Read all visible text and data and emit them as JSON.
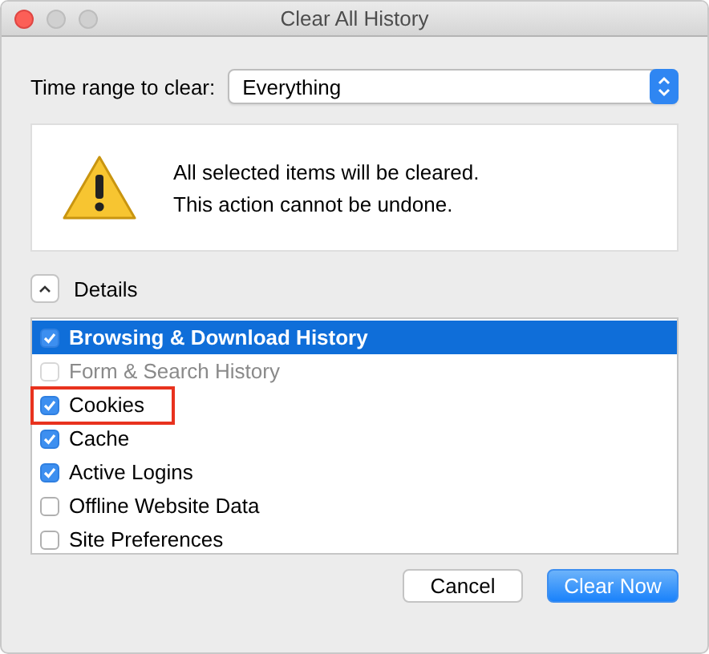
{
  "window": {
    "title": "Clear All History"
  },
  "time_range": {
    "label": "Time range to clear:",
    "value": "Everything"
  },
  "warning": {
    "lines": [
      "All selected items will be cleared.",
      "This action cannot be undone."
    ]
  },
  "details": {
    "label": "Details",
    "expanded": true
  },
  "items": [
    {
      "label": "Browsing & Download History",
      "checked": true,
      "selected": true,
      "disabled": false,
      "marked": false
    },
    {
      "label": "Form & Search History",
      "checked": false,
      "selected": false,
      "disabled": true,
      "marked": false
    },
    {
      "label": "Cookies",
      "checked": true,
      "selected": false,
      "disabled": false,
      "marked": true
    },
    {
      "label": "Cache",
      "checked": true,
      "selected": false,
      "disabled": false,
      "marked": false
    },
    {
      "label": "Active Logins",
      "checked": true,
      "selected": false,
      "disabled": false,
      "marked": false
    },
    {
      "label": "Offline Website Data",
      "checked": false,
      "selected": false,
      "disabled": false,
      "marked": false
    },
    {
      "label": "Site Preferences",
      "checked": false,
      "selected": false,
      "disabled": false,
      "marked": false
    }
  ],
  "buttons": [
    {
      "label": "Cancel",
      "kind": "secondary"
    },
    {
      "label": "Clear Now",
      "kind": "primary"
    }
  ]
}
